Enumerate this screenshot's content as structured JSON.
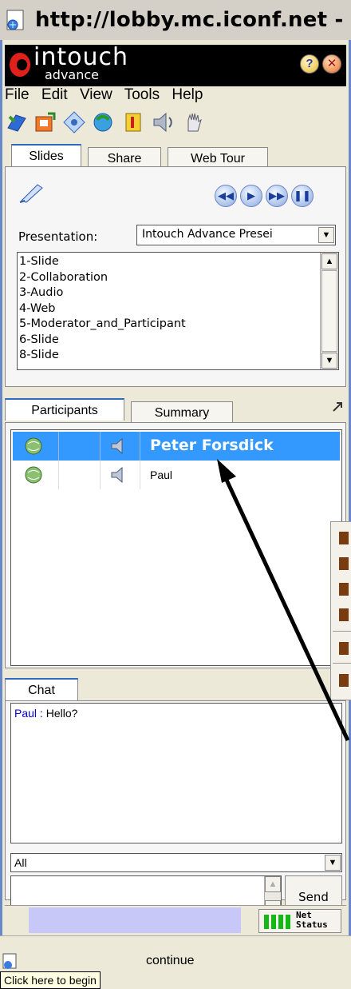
{
  "browser": {
    "url": "http://lobby.mc.iconf.net -"
  },
  "logo": {
    "brand": "intouch",
    "sub": "advance"
  },
  "menu": [
    "File",
    "Edit",
    "View",
    "Tools",
    "Help"
  ],
  "tabs_top": [
    {
      "label": "Slides",
      "active": true
    },
    {
      "label": "Share",
      "active": false
    },
    {
      "label": "Web Tour",
      "active": false
    }
  ],
  "presentation": {
    "label": "Presentation:",
    "selected": "Intouch Advance Presei",
    "slides": [
      "1-Slide",
      "2-Collaboration",
      "3-Audio",
      "4-Web",
      "5-Moderator_and_Participant",
      "6-Slide",
      "8-Slide"
    ]
  },
  "tabs_mid": [
    {
      "label": "Participants",
      "active": true
    },
    {
      "label": "Summary",
      "active": false
    }
  ],
  "participants": [
    {
      "name": "Peter Forsdick",
      "selected": true
    },
    {
      "name": "Paul",
      "selected": false
    }
  ],
  "chat": {
    "tab": "Chat",
    "messages": [
      {
        "sender": "Paul :",
        "text": "Hello?"
      }
    ],
    "recipient": "All",
    "send_label": "Send"
  },
  "status": {
    "net_line1": "Net",
    "net_line2": "Status"
  },
  "bottom": {
    "status_text": "continue",
    "tooltip": "Click here to begin"
  },
  "colors": {
    "selection": "#3399ff",
    "accent": "#316ac5",
    "chat_sender": "#0000cc"
  }
}
